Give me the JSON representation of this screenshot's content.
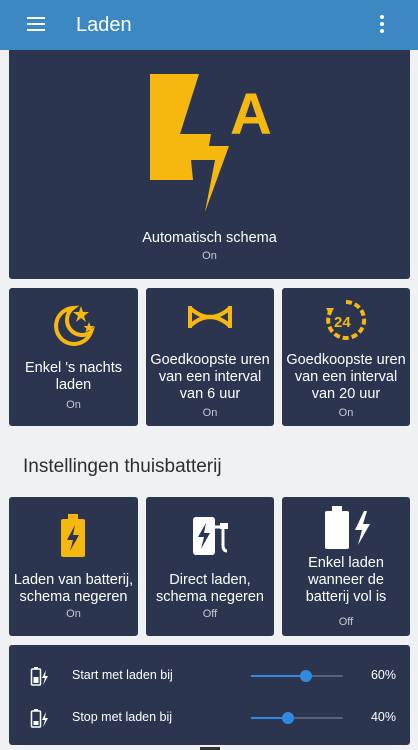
{
  "header": {
    "title": "Laden",
    "menu_icon": "hamburger-menu-icon",
    "more_icon": "more-vert-icon"
  },
  "colors": {
    "appbar": "#3b88c3",
    "card": "#2b3550",
    "accent": "#f6b80f",
    "slider": "#2f8ae0",
    "background": "#f0f1f3"
  },
  "hero": {
    "label": "Automatisch schema",
    "state": "On",
    "icon": "lightning-auto-icon"
  },
  "tiles": [
    {
      "label": "Enkel 's nachts laden",
      "state": "On",
      "icon": "moon-stars-icon"
    },
    {
      "label": "Goedkoopste uren van een interval van 6 uur",
      "state": "On",
      "icon": "interval-6h-icon"
    },
    {
      "label": "Goedkoopste uren van een interval van 20 uur",
      "state": "On",
      "icon": "clock-24-icon"
    }
  ],
  "section": {
    "title": "Instellingen thuisbatterij"
  },
  "battery_tiles": [
    {
      "label": "Laden van batterij, schema negeren",
      "state": "On",
      "icon": "battery-charging-icon"
    },
    {
      "label": "Direct laden, schema negeren",
      "state": "Off",
      "icon": "ev-charger-icon"
    },
    {
      "label": "Enkel laden wanneer de batterij vol is",
      "state": "Off",
      "icon": "battery-bolt-icon"
    }
  ],
  "sliders": [
    {
      "label": "Start met laden bij",
      "value": 60,
      "display": "60%",
      "icon": "battery-start-icon"
    },
    {
      "label": "Stop met laden bij",
      "value": 40,
      "display": "40%",
      "icon": "battery-stop-icon"
    }
  ]
}
